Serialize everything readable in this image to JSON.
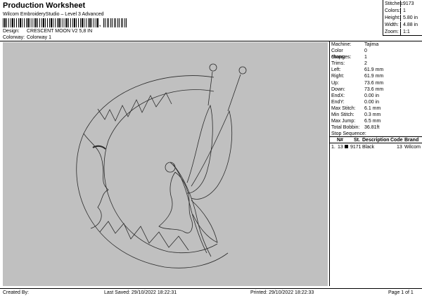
{
  "header": {
    "title": "Production Worksheet",
    "subtitle": "Wilcom EmbroideryStudio – Level 3 Advanced"
  },
  "meta": {
    "design_label": "Design:",
    "design_value": "CRESCENT MOON V2 5,8 IN",
    "colorway_label": "Colorway:",
    "colorway_value": "Colorway 1"
  },
  "summary": [
    {
      "label": "Stitches:",
      "value": "9173"
    },
    {
      "label": "Colors:",
      "value": "1"
    },
    {
      "label": "Height:",
      "value": "5.80 in"
    },
    {
      "label": "Width:",
      "value": "4.88 in"
    },
    {
      "label": "Zoom:",
      "value": "1:1"
    }
  ],
  "details": [
    {
      "label": "Machine:",
      "value": "Tajima"
    },
    {
      "label": "Color changes:",
      "value": "0"
    },
    {
      "label": "Stops:",
      "value": "1"
    },
    {
      "label": "Trims:",
      "value": "2"
    },
    {
      "label": "Left:",
      "value": "61.9 mm"
    },
    {
      "label": "Right:",
      "value": "61.9 mm"
    },
    {
      "label": "Up:",
      "value": "73.6 mm"
    },
    {
      "label": "Down:",
      "value": "73.6 mm"
    },
    {
      "label": "EndX:",
      "value": "0.00 in"
    },
    {
      "label": "EndY:",
      "value": "0.00 in"
    },
    {
      "label": "Max Stitch:",
      "value": "6.1 mm"
    },
    {
      "label": "Min Stitch:",
      "value": "0.3 mm"
    },
    {
      "label": "Max Jump:",
      "value": "6.5 mm"
    },
    {
      "label": "Total Bobbin:",
      "value": "36.81ft"
    }
  ],
  "sequence": {
    "heading": "Stop Sequence:",
    "columns": {
      "num": "N#",
      "st": "St.",
      "description": "Description",
      "code": "Code",
      "brand": "Brand"
    },
    "rows": [
      {
        "index": "1.",
        "num": "13",
        "color": "#000000",
        "st": "9171",
        "description": "Black",
        "code": "13",
        "brand": "Wilcom"
      }
    ]
  },
  "footer": {
    "created": "Created By:",
    "last_saved": "Last Saved: 29/10/2022 18:22:31",
    "printed": "Printed: 29/10/2022 18:22:33",
    "page": "Page 1 of 1"
  },
  "colors": {
    "canvas": "#c0c0c0",
    "thread": "#000000"
  }
}
